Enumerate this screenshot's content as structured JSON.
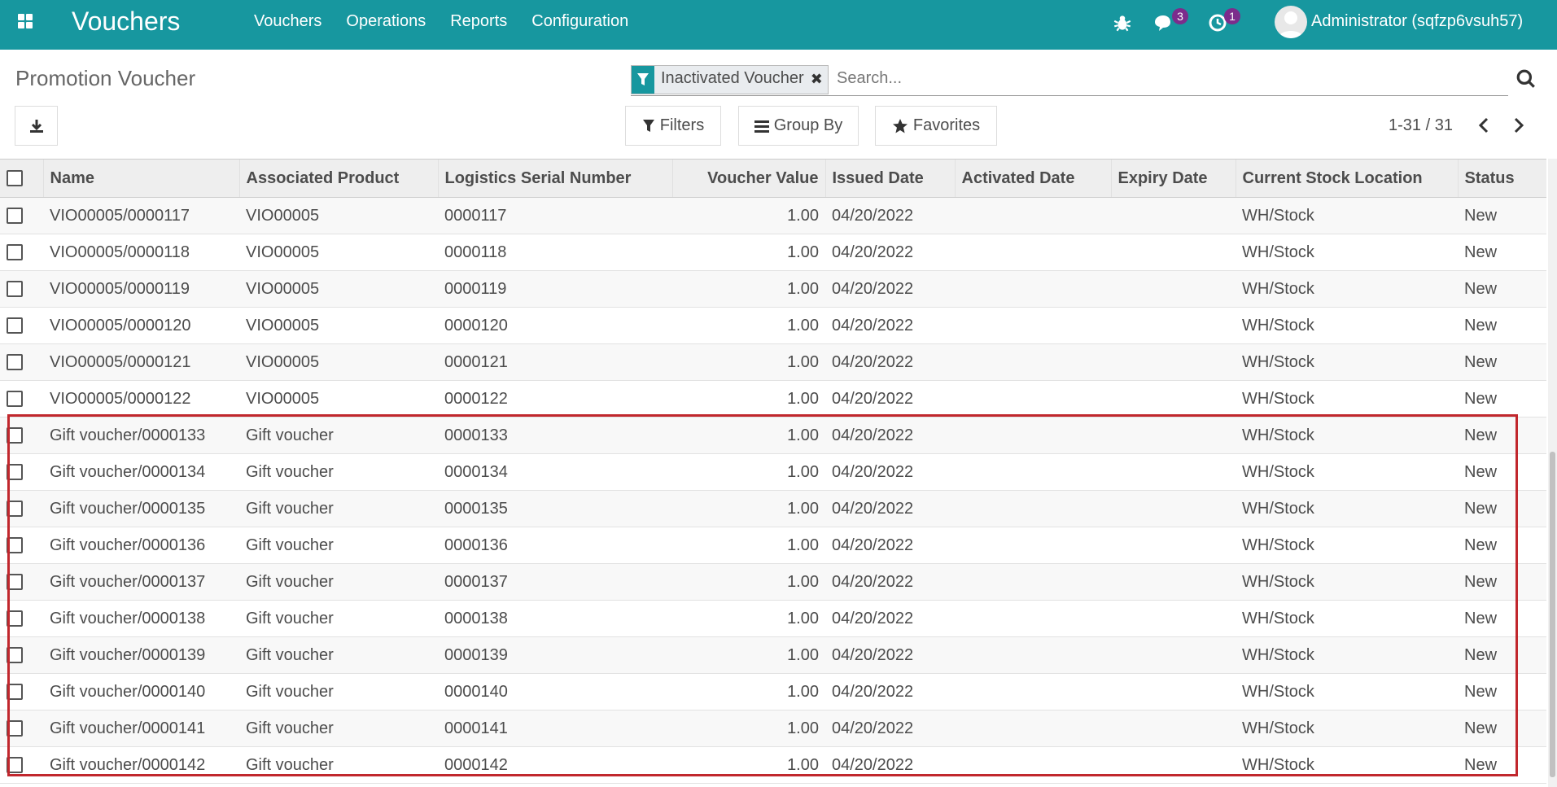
{
  "navbar": {
    "brand": "Vouchers",
    "menu": [
      "Vouchers",
      "Operations",
      "Reports",
      "Configuration"
    ],
    "messages_badge": "3",
    "activities_badge": "1",
    "user": "Administrator (sqfzp6vsuh57)",
    "bg_color": "#17979f"
  },
  "control": {
    "title": "Promotion Voucher",
    "facet_label": "Inactivated Voucher",
    "search_placeholder": "Search...",
    "filters_label": "Filters",
    "groupby_label": "Group By",
    "favorites_label": "Favorites",
    "pager": "1-31 / 31"
  },
  "table": {
    "columns": [
      "Name",
      "Associated Product",
      "Logistics Serial Number",
      "Voucher Value",
      "Issued Date",
      "Activated Date",
      "Expiry Date",
      "Current Stock Location",
      "Status"
    ],
    "rows": [
      {
        "name": "VIO00005/0000117",
        "product": "VIO00005",
        "serial": "0000117",
        "value": "1.00",
        "issued": "04/20/2022",
        "activated": "",
        "expiry": "",
        "location": "WH/Stock",
        "status": "New"
      },
      {
        "name": "VIO00005/0000118",
        "product": "VIO00005",
        "serial": "0000118",
        "value": "1.00",
        "issued": "04/20/2022",
        "activated": "",
        "expiry": "",
        "location": "WH/Stock",
        "status": "New"
      },
      {
        "name": "VIO00005/0000119",
        "product": "VIO00005",
        "serial": "0000119",
        "value": "1.00",
        "issued": "04/20/2022",
        "activated": "",
        "expiry": "",
        "location": "WH/Stock",
        "status": "New"
      },
      {
        "name": "VIO00005/0000120",
        "product": "VIO00005",
        "serial": "0000120",
        "value": "1.00",
        "issued": "04/20/2022",
        "activated": "",
        "expiry": "",
        "location": "WH/Stock",
        "status": "New"
      },
      {
        "name": "VIO00005/0000121",
        "product": "VIO00005",
        "serial": "0000121",
        "value": "1.00",
        "issued": "04/20/2022",
        "activated": "",
        "expiry": "",
        "location": "WH/Stock",
        "status": "New"
      },
      {
        "name": "VIO00005/0000122",
        "product": "VIO00005",
        "serial": "0000122",
        "value": "1.00",
        "issued": "04/20/2022",
        "activated": "",
        "expiry": "",
        "location": "WH/Stock",
        "status": "New"
      },
      {
        "name": "Gift voucher/0000133",
        "product": "Gift voucher",
        "serial": "0000133",
        "value": "1.00",
        "issued": "04/20/2022",
        "activated": "",
        "expiry": "",
        "location": "WH/Stock",
        "status": "New"
      },
      {
        "name": "Gift voucher/0000134",
        "product": "Gift voucher",
        "serial": "0000134",
        "value": "1.00",
        "issued": "04/20/2022",
        "activated": "",
        "expiry": "",
        "location": "WH/Stock",
        "status": "New"
      },
      {
        "name": "Gift voucher/0000135",
        "product": "Gift voucher",
        "serial": "0000135",
        "value": "1.00",
        "issued": "04/20/2022",
        "activated": "",
        "expiry": "",
        "location": "WH/Stock",
        "status": "New"
      },
      {
        "name": "Gift voucher/0000136",
        "product": "Gift voucher",
        "serial": "0000136",
        "value": "1.00",
        "issued": "04/20/2022",
        "activated": "",
        "expiry": "",
        "location": "WH/Stock",
        "status": "New"
      },
      {
        "name": "Gift voucher/0000137",
        "product": "Gift voucher",
        "serial": "0000137",
        "value": "1.00",
        "issued": "04/20/2022",
        "activated": "",
        "expiry": "",
        "location": "WH/Stock",
        "status": "New"
      },
      {
        "name": "Gift voucher/0000138",
        "product": "Gift voucher",
        "serial": "0000138",
        "value": "1.00",
        "issued": "04/20/2022",
        "activated": "",
        "expiry": "",
        "location": "WH/Stock",
        "status": "New"
      },
      {
        "name": "Gift voucher/0000139",
        "product": "Gift voucher",
        "serial": "0000139",
        "value": "1.00",
        "issued": "04/20/2022",
        "activated": "",
        "expiry": "",
        "location": "WH/Stock",
        "status": "New"
      },
      {
        "name": "Gift voucher/0000140",
        "product": "Gift voucher",
        "serial": "0000140",
        "value": "1.00",
        "issued": "04/20/2022",
        "activated": "",
        "expiry": "",
        "location": "WH/Stock",
        "status": "New"
      },
      {
        "name": "Gift voucher/0000141",
        "product": "Gift voucher",
        "serial": "0000141",
        "value": "1.00",
        "issued": "04/20/2022",
        "activated": "",
        "expiry": "",
        "location": "WH/Stock",
        "status": "New"
      },
      {
        "name": "Gift voucher/0000142",
        "product": "Gift voucher",
        "serial": "0000142",
        "value": "1.00",
        "issued": "04/20/2022",
        "activated": "",
        "expiry": "",
        "location": "WH/Stock",
        "status": "New"
      }
    ]
  },
  "highlight_color": "#c1272d"
}
